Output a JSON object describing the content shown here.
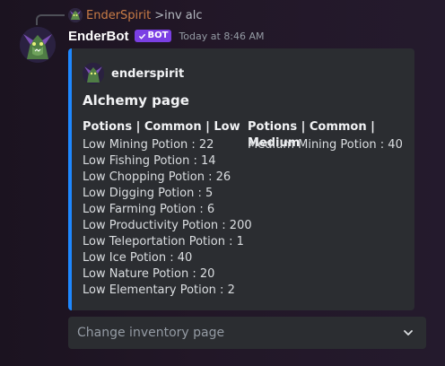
{
  "reply": {
    "author": "EnderSpirit",
    "command": ">inv alc"
  },
  "message": {
    "author": "EnderBot",
    "badge": "BOT",
    "timestamp": "Today at 8:46 AM"
  },
  "embed": {
    "author": "enderspirit",
    "title": "Alchemy page",
    "accent_color": "#1e88ff",
    "fields": [
      {
        "name": "Potions | Common | Low",
        "lines": [
          "Low Mining Potion : 22",
          "Low Fishing Potion : 14",
          "Low Chopping Potion : 26",
          "Low Digging Potion : 5",
          "Low Farming Potion : 6",
          "Low Productivity Potion : 200",
          "Low Teleportation Potion : 1",
          "Low Ice Potion : 40",
          "Low Nature Potion : 20",
          "Low Elementary Potion : 2"
        ]
      },
      {
        "name": "Potions | Common | Medium",
        "lines": [
          "Medium Mining Potion : 40"
        ]
      }
    ]
  },
  "select_menu": {
    "placeholder": "Change inventory page",
    "icon": "chevron-down-icon"
  },
  "icons": {
    "avatar": "dragon-avatar-icon",
    "verified": "check-icon"
  }
}
